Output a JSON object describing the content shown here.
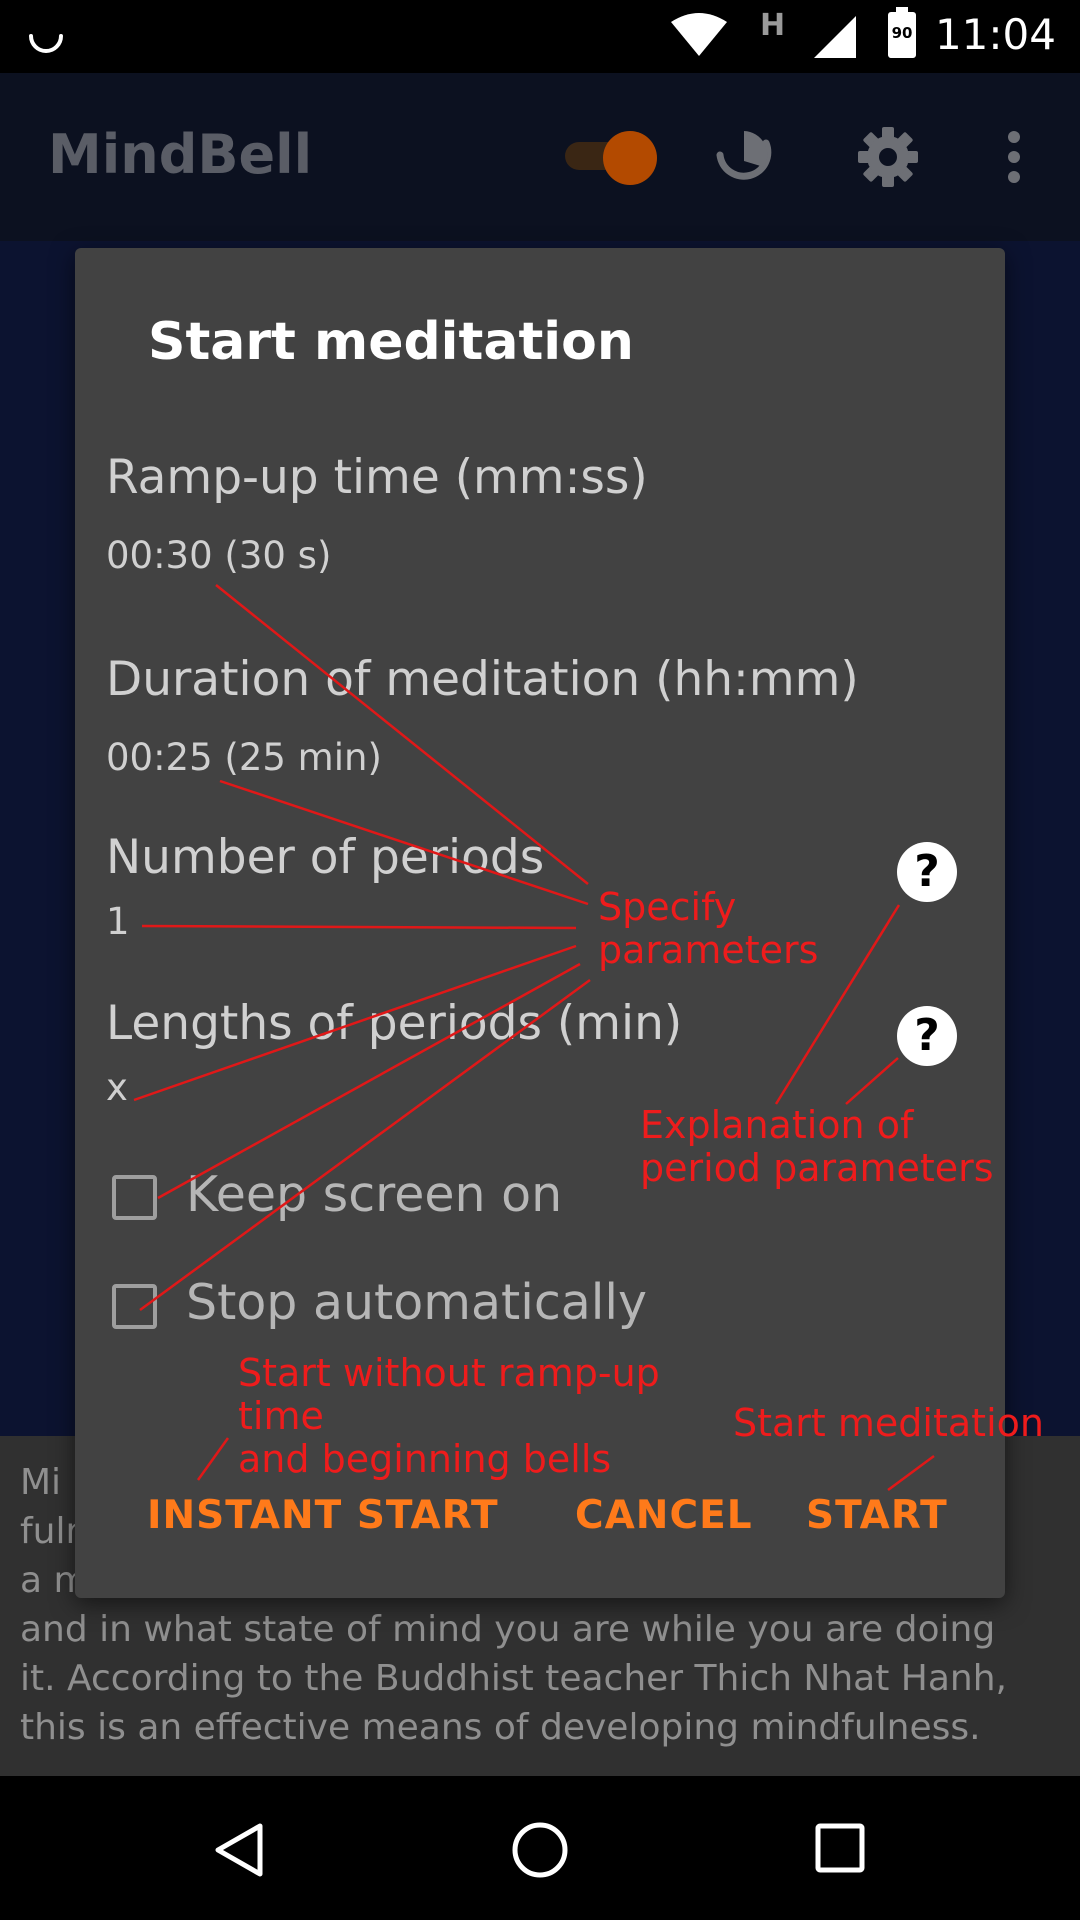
{
  "status_bar": {
    "time": "11:04",
    "battery_level": "90",
    "network_type": "H",
    "icons": [
      "loading-icon",
      "wifi-icon",
      "network-type-icon",
      "signal-icon",
      "battery-icon"
    ]
  },
  "app_bar": {
    "title": "MindBell",
    "icons": [
      "toggle-switch",
      "meditation-icon",
      "settings-icon",
      "overflow-menu-icon"
    ],
    "toggle_on": true
  },
  "background": {
    "paragraph": "Mindfulness bell reminds you to pause for a moment and to become aware of what you are doing, and in what state of mind you are while you are doing it. According to the Buddhist teacher Thich Nhat Hanh, this is an effective means of developing mindfulness.",
    "paragraph_visible_lines": [
      "Mi",
      "fuln",
      "a m",
      "and in what state of mind you are while you are doing",
      "it. According to the Buddhist teacher Thich Nhat Hanh,",
      "this is an effective means of developing mindfulness."
    ]
  },
  "dialog": {
    "title": "Start meditation",
    "fields": [
      {
        "label": "Ramp-up time (mm:ss)",
        "value": "00:30 (30 s)"
      },
      {
        "label": "Duration of meditation (hh:mm)",
        "value": "00:25 (25 min)"
      },
      {
        "label": "Number of periods",
        "value": "1"
      },
      {
        "label": "Lengths of periods (min)",
        "value": "x"
      }
    ],
    "help_icon_label": "?",
    "checkboxes": [
      {
        "label": "Keep screen on",
        "checked": false
      },
      {
        "label": "Stop automatically",
        "checked": false
      }
    ],
    "buttons": {
      "instant_start": "INSTANT START",
      "cancel": "CANCEL",
      "start": "START"
    }
  },
  "annotations": {
    "specify_parameters": "Specify\nparameters",
    "explanation": "Explanation of\nperiod parameters",
    "start_without": "Start without ramp-up\ntime\nand beginning bells",
    "start_meditation": "Start meditation"
  },
  "nav_bar": {
    "icons": [
      "back-icon",
      "home-icon",
      "recents-icon"
    ]
  },
  "colors": {
    "dialog_bg": "#424242",
    "accent": "#ff7a1a",
    "annotation": "#ee1c1c",
    "app_bar_bg": "#0c1120"
  }
}
